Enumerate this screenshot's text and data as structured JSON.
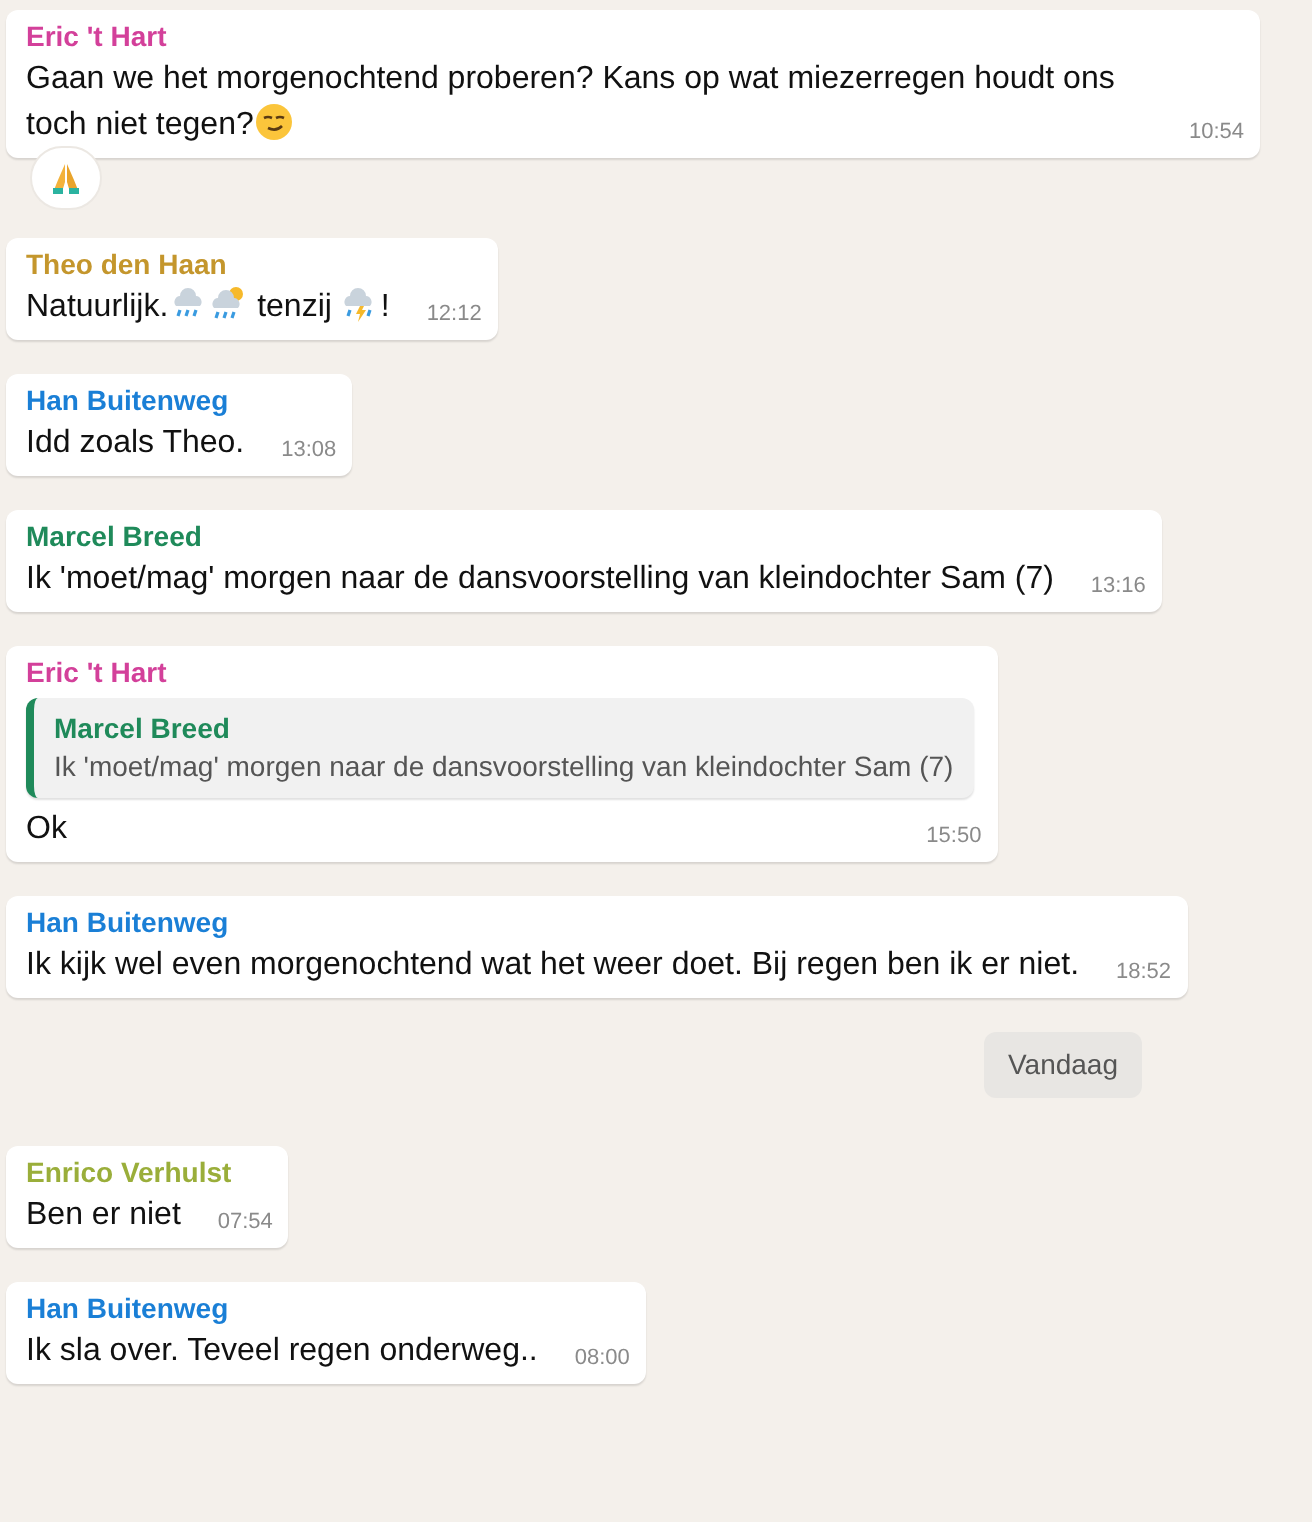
{
  "messages": [
    {
      "kind": "message",
      "sender": "Eric 't Hart",
      "color": "#d3409a",
      "parts": [
        {
          "kind": "text",
          "text": "Gaan we het morgenochtend proberen? Kans op wat miezerregen houdt ons"
        },
        {
          "kind": "text",
          "text": " toch niet tegen?"
        },
        {
          "kind": "smirk"
        }
      ],
      "time": "10:54",
      "reaction": {
        "kind": "pray"
      }
    },
    {
      "kind": "message",
      "sender": "Theo den Haan",
      "color": "#c4962c",
      "parts": [
        {
          "kind": "text",
          "text": "Natuurlijk."
        },
        {
          "kind": "rain"
        },
        {
          "kind": "sunshower"
        },
        {
          "kind": "text",
          "text": " tenzij "
        },
        {
          "kind": "storm"
        },
        {
          "kind": "text",
          "text": "!"
        }
      ],
      "time": "12:12"
    },
    {
      "kind": "message",
      "sender": "Han Buitenweg",
      "color": "#1a7fd6",
      "parts": [
        {
          "kind": "text",
          "text": "Idd zoals Theo."
        }
      ],
      "time": "13:08"
    },
    {
      "kind": "message",
      "sender": "Marcel Breed",
      "color": "#1f8a5a",
      "parts": [
        {
          "kind": "text",
          "text": "Ik 'moet/mag' morgen naar de dansvoorstelling van kleindochter Sam (7)"
        }
      ],
      "time": "13:16"
    },
    {
      "kind": "message",
      "sender": "Eric 't Hart",
      "color": "#d3409a",
      "quote": {
        "sender": "Marcel Breed",
        "color": "#1f8a5a",
        "text": "Ik 'moet/mag' morgen naar de dansvoorstelling van kleindochter Sam (7)"
      },
      "parts": [
        {
          "kind": "text",
          "text": "Ok"
        }
      ],
      "time": "15:50"
    },
    {
      "kind": "message",
      "sender": "Han Buitenweg",
      "color": "#1a7fd6",
      "parts": [
        {
          "kind": "text",
          "text": "Ik kijk wel even morgenochtend wat het weer doet. Bij regen ben ik er niet."
        }
      ],
      "time": "18:52"
    },
    {
      "kind": "date",
      "text": "Vandaag"
    },
    {
      "kind": "message",
      "sender": "Enrico Verhulst",
      "color": "#9aae3a",
      "parts": [
        {
          "kind": "text",
          "text": "Ben er niet"
        }
      ],
      "time": "07:54"
    },
    {
      "kind": "message",
      "sender": "Han Buitenweg",
      "color": "#1a7fd6",
      "parts": [
        {
          "kind": "text",
          "text": "Ik sla over. Teveel regen onderweg.."
        }
      ],
      "time": "08:00"
    }
  ]
}
